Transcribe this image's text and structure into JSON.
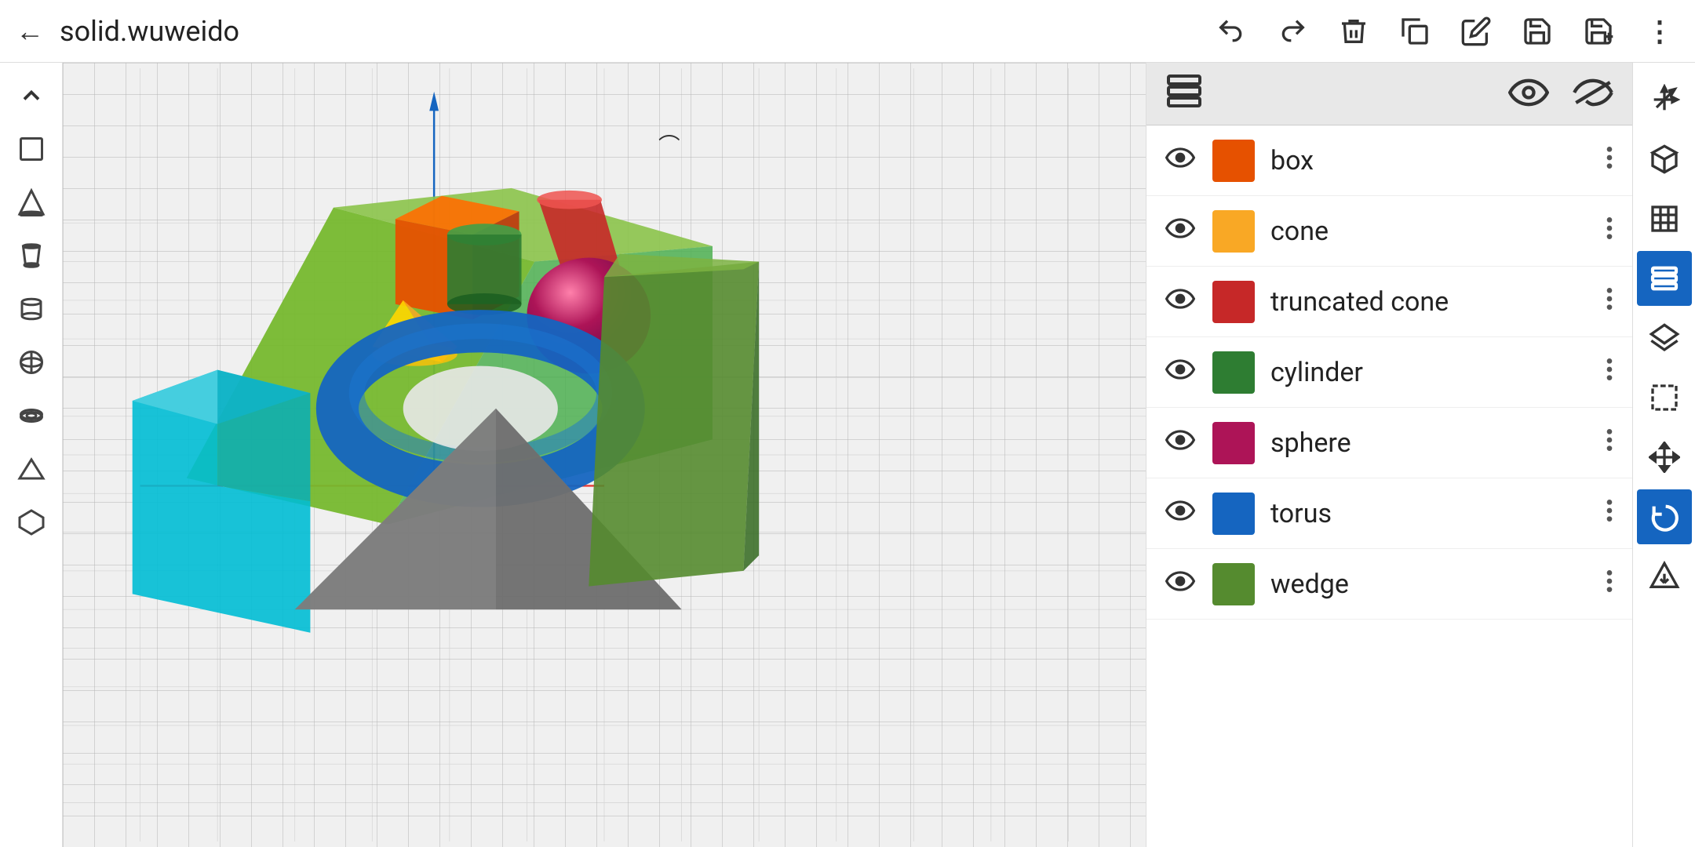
{
  "header": {
    "back_label": "‹",
    "title": "solid.wuweido",
    "actions": {
      "undo_label": "←",
      "redo_label": "→",
      "delete_label": "🗑",
      "copy_label": "⧉",
      "edit_label": "✎",
      "save_label": "💾",
      "save_add_label": "💾+",
      "more_label": "⋮"
    }
  },
  "left_toolbar": {
    "tools": [
      {
        "name": "collapse",
        "icon": "∧",
        "label": "collapse"
      },
      {
        "name": "box-tool",
        "icon": "□",
        "label": "box"
      },
      {
        "name": "cone-tool",
        "icon": "△",
        "label": "cone"
      },
      {
        "name": "trunc-cone-tool",
        "icon": "⌂",
        "label": "truncated cone"
      },
      {
        "name": "cylinder-tool",
        "icon": "⬭",
        "label": "cylinder"
      },
      {
        "name": "sphere-tool",
        "icon": "◎",
        "label": "sphere"
      },
      {
        "name": "torus-tool",
        "icon": "⊙",
        "label": "torus"
      },
      {
        "name": "wedge-tool",
        "icon": "◁",
        "label": "wedge"
      },
      {
        "name": "prism-tool",
        "icon": "⬡",
        "label": "prism"
      }
    ]
  },
  "panel": {
    "header": {
      "list_icon": "☰",
      "eye_open": "👁",
      "eye_closed": "—"
    },
    "objects": [
      {
        "name": "box",
        "color": "#E65100",
        "visible": true
      },
      {
        "name": "cone",
        "color": "#F9A825",
        "visible": true
      },
      {
        "name": "truncated cone",
        "color": "#C62828",
        "visible": true
      },
      {
        "name": "cylinder",
        "color": "#2E7D32",
        "visible": true
      },
      {
        "name": "sphere",
        "color": "#AD1457",
        "visible": true
      },
      {
        "name": "torus",
        "color": "#1565C0",
        "visible": true
      },
      {
        "name": "wedge",
        "color": "#558B2F",
        "visible": true
      }
    ]
  },
  "far_right_toolbar": {
    "tools": [
      {
        "name": "3d-axes",
        "icon": "⊹",
        "label": "3D axes",
        "active": false
      },
      {
        "name": "3d-view",
        "icon": "⬡",
        "label": "3D view",
        "active": false
      },
      {
        "name": "grid",
        "icon": "⊞",
        "label": "grid",
        "active": false
      },
      {
        "name": "list-view",
        "icon": "≡",
        "label": "list view",
        "active": true,
        "class": "active-blue"
      },
      {
        "name": "layers",
        "icon": "⧉",
        "label": "layers",
        "active": false
      },
      {
        "name": "selection",
        "icon": "⬜",
        "label": "selection",
        "active": false
      },
      {
        "name": "move",
        "icon": "✛",
        "label": "move",
        "active": false
      },
      {
        "name": "rotate",
        "icon": "↺",
        "label": "rotate",
        "active": true,
        "class": "active-blue2"
      },
      {
        "name": "import",
        "icon": "⬇",
        "label": "import",
        "active": false
      }
    ]
  }
}
